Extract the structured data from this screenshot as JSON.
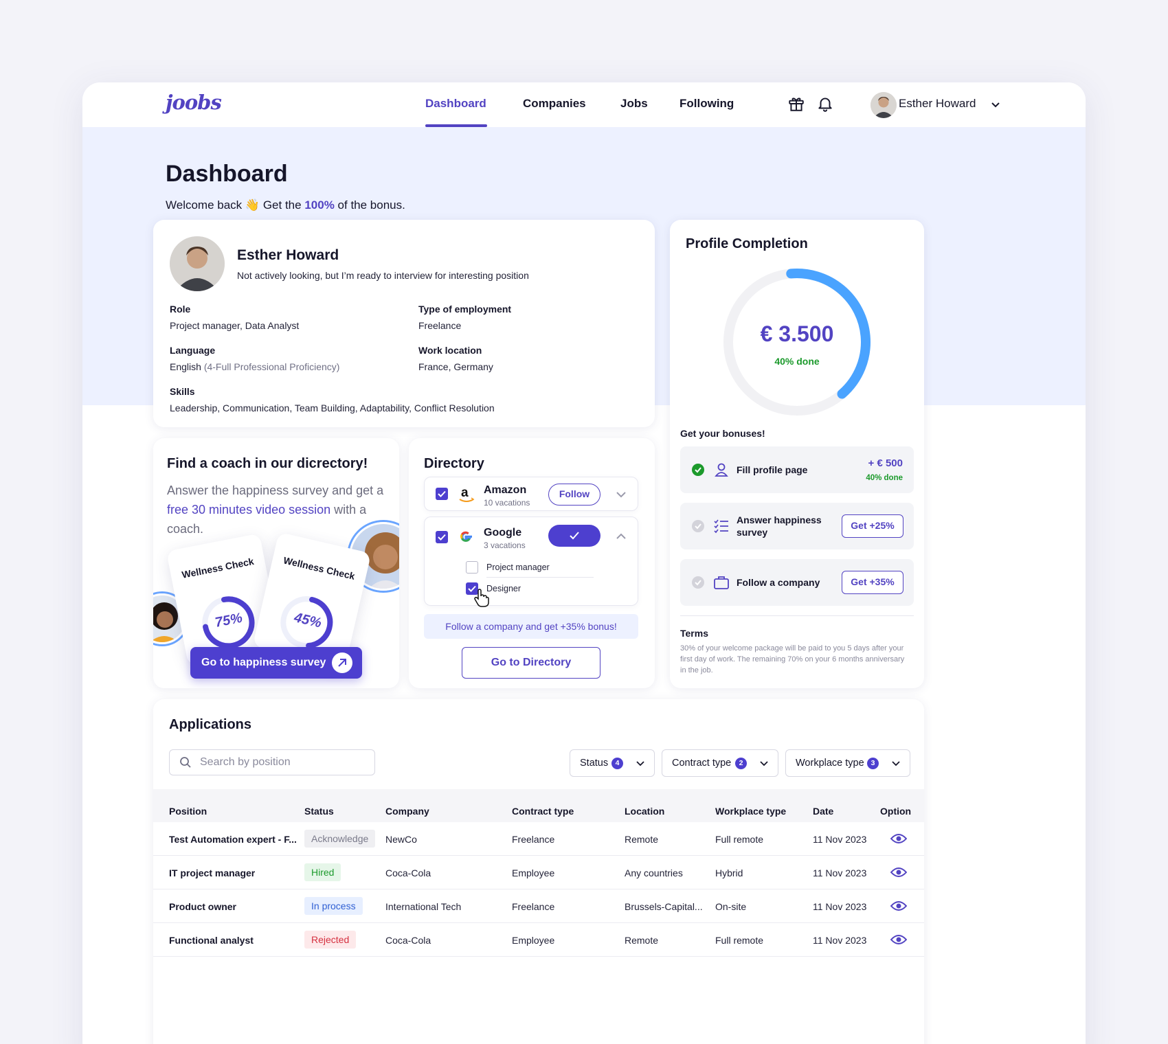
{
  "nav": {
    "logo": "joobs",
    "links": [
      {
        "label": "Dashboard",
        "active": true
      },
      {
        "label": "Companies",
        "active": false
      },
      {
        "label": "Jobs",
        "active": false
      },
      {
        "label": "Following",
        "active": false
      }
    ],
    "user_name": "Esther Howard"
  },
  "header": {
    "title": "Dashboard",
    "welcome_prefix": "Welcome back",
    "welcome_emoji": "👋",
    "welcome_mid": "Get the",
    "welcome_highlight": "100%",
    "welcome_suffix": "of the bonus."
  },
  "profile": {
    "name": "Esther Howard",
    "status": "Not actively looking, but I’m ready to interview for interesting position",
    "role_label": "Role",
    "role_value": "Project manager, Data Analyst",
    "employment_label": "Type of employment",
    "employment_value": "Freelance",
    "language_label": "Language",
    "language_value": "English",
    "language_note": "(4-Full Professional Proficiency)",
    "location_label": "Work location",
    "location_value": "France, Germany",
    "skills_label": "Skills",
    "skills_value": "Leadership, Communication, Team Building, Adaptability, Conflict Resolution"
  },
  "coach": {
    "title": "Find a coach in our dicrectory!",
    "desc_prefix": "Answer the happiness survey and get a",
    "desc_link": "free 30 minutes video session",
    "desc_suffix": "with a coach.",
    "card1_title": "Wellness Check",
    "card1_value": "75%",
    "card1_fraction": 0.75,
    "card2_title": "Wellness Check",
    "card2_value": "45%",
    "card2_fraction": 0.45,
    "button": "Go to happiness survey"
  },
  "directory": {
    "title": "Directory",
    "items": [
      {
        "name": "Amazon",
        "sub": "10 vacations",
        "button": "Follow",
        "checked": true
      },
      {
        "name": "Google",
        "sub": "3 vacations",
        "checked": true,
        "roles": [
          {
            "label": "Project manager",
            "checked": false
          },
          {
            "label": "Designer",
            "checked": true
          }
        ]
      }
    ],
    "banner": "Follow a company and get +35% bonus!",
    "button": "Go to Directory"
  },
  "completion": {
    "title": "Profile Completion",
    "amount": "€ 3.500",
    "done": "40% done",
    "progress": 0.4,
    "bonuses_title": "Get your bonuses!",
    "bonuses": [
      {
        "label": "Fill profile page",
        "amount": "+ € 500",
        "amount_sub": "40% done",
        "completed": true
      },
      {
        "label": "Answer happiness survey",
        "button": "Get +25%",
        "completed": false
      },
      {
        "label": "Follow a company",
        "button": "Get +35%",
        "completed": false
      }
    ],
    "terms_title": "Terms",
    "terms_text": "30% of your welcome package will be paid to you 5 days after your first day of work. The remaining 70% on your 6 months anniversary in the job.",
    "colors": {
      "ring": "#4aa3ff",
      "accent": "#5243c2",
      "success": "#1c9a2c"
    }
  },
  "applications": {
    "title": "Applications",
    "search_placeholder": "Search by position",
    "filters": [
      {
        "label": "Status",
        "count": "4"
      },
      {
        "label": "Contract type",
        "count": "2"
      },
      {
        "label": "Workplace type",
        "count": "3"
      }
    ],
    "columns": [
      "Position",
      "Status",
      "Company",
      "Contract type",
      "Location",
      "Workplace type",
      "Date",
      "Option"
    ],
    "rows": [
      {
        "position": "Test Automation expert - F...",
        "status": "Acknowledge",
        "company": "NewCo",
        "contract": "Freelance",
        "location": "Remote",
        "workplace": "Full remote",
        "date": "11 Nov 2023"
      },
      {
        "position": "IT project manager",
        "status": "Hired",
        "company": "Coca-Cola",
        "contract": "Employee",
        "location": "Any countries",
        "workplace": "Hybrid",
        "date": "11 Nov 2023"
      },
      {
        "position": "Product owner",
        "status": "In process",
        "company": "International Tech",
        "contract": "Freelance",
        "location": "Brussels-Capital...",
        "workplace": "On-site",
        "date": "11 Nov 2023"
      },
      {
        "position": "Functional analyst",
        "status": "Rejected",
        "company": "Coca-Cola",
        "contract": "Employee",
        "location": "Remote",
        "workplace": "Full remote",
        "date": "11 Nov 2023"
      }
    ]
  }
}
